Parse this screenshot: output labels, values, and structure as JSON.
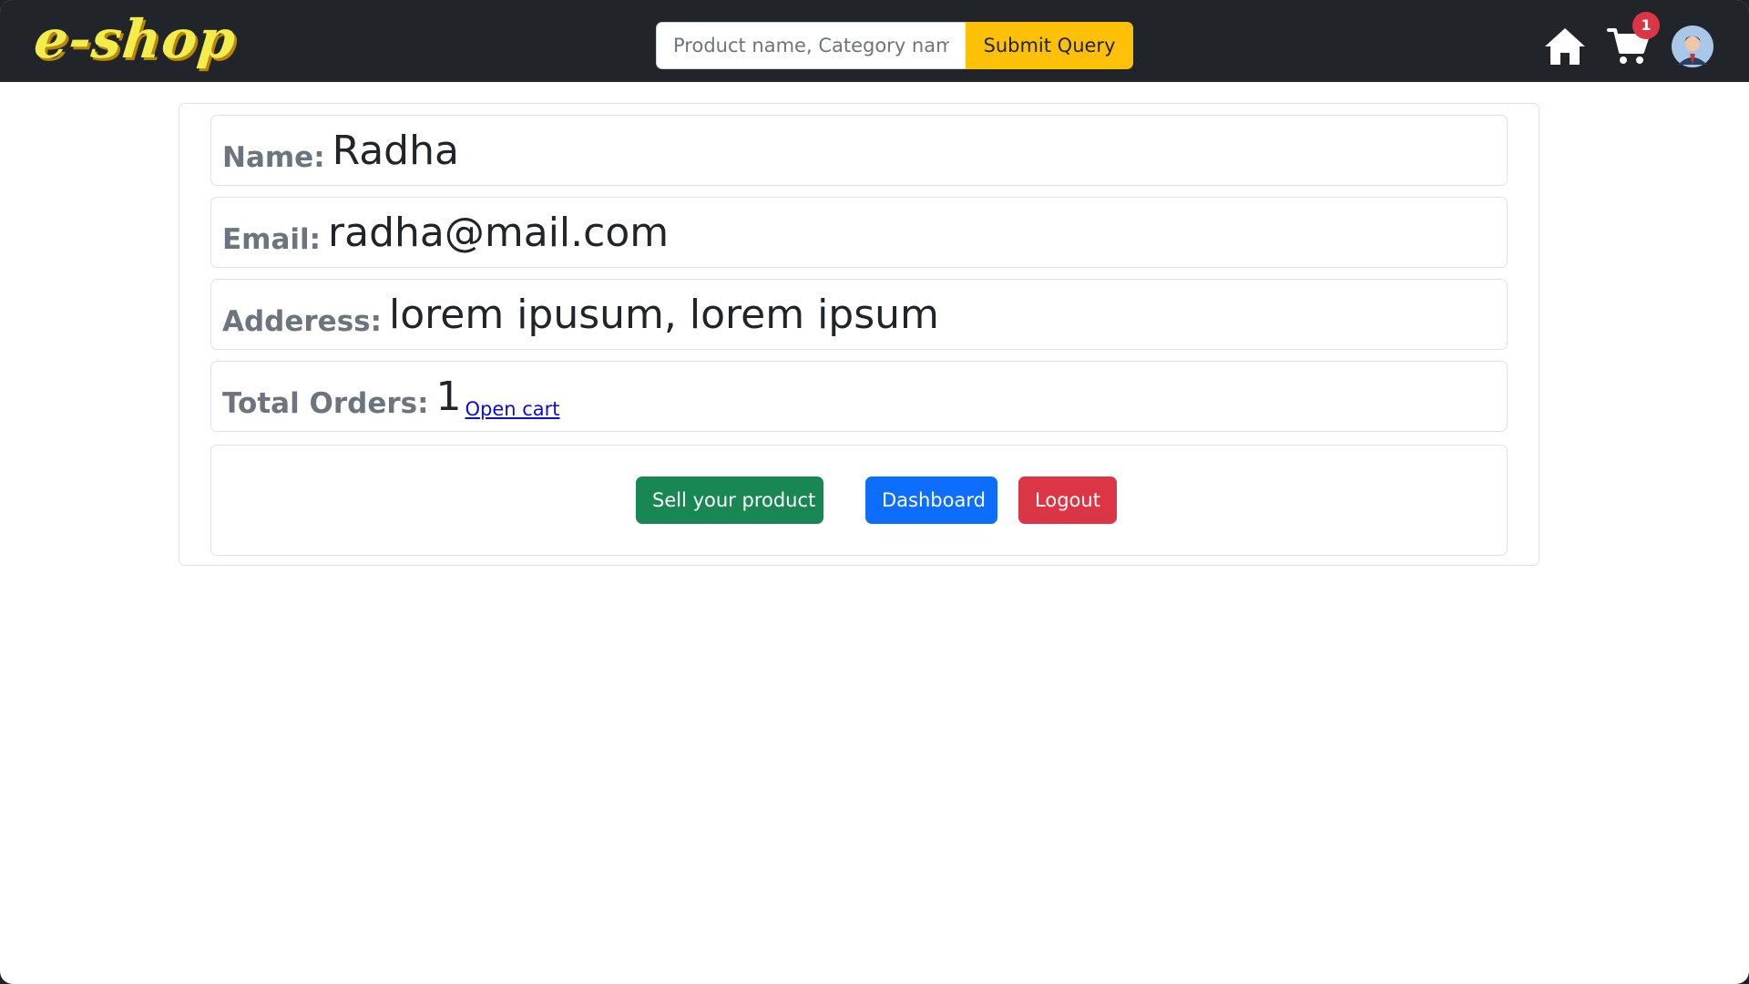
{
  "navbar": {
    "brand": "e-shop",
    "search": {
      "placeholder": "Product name, Category name",
      "value": "",
      "submit_label": "Submit Query"
    },
    "icons": {
      "home": "home-icon",
      "cart": "cart-icon",
      "profile": "avatar-icon"
    },
    "cart_count": "1"
  },
  "profile": {
    "name_label": "Name:",
    "name_value": "Radha",
    "email_label": "Email:",
    "email_value": "radha@mail.com",
    "address_label": "Adderess:",
    "address_value": "lorem ipusum, lorem ipsum",
    "orders_label": "Total Orders:",
    "orders_value": "1",
    "open_cart_label": "Open cart"
  },
  "actions": {
    "sell_label": "Sell your product",
    "dashboard_label": "Dashboard",
    "logout_label": "Logout"
  },
  "colors": {
    "navbar_bg": "#212529",
    "brand": "#f4ec4a",
    "search_button": "#ffc107",
    "success": "#198754",
    "primary": "#0d6efd",
    "danger": "#dc3545"
  }
}
